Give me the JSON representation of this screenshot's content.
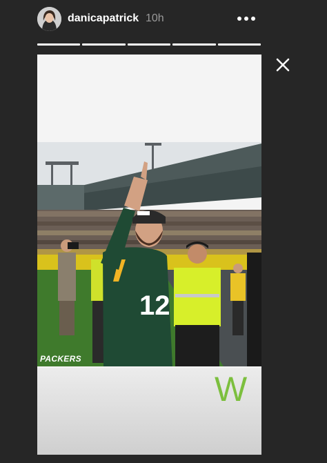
{
  "story": {
    "username": "danicapatrick",
    "timestamp": "10h",
    "segment_count": 5,
    "photo_watermark": "PACKERS",
    "caption_letter": "W"
  },
  "jersey_number": "12",
  "colors": {
    "background": "#262626",
    "accent_green": "#7cbf3e",
    "text_primary": "#ffffff",
    "text_secondary": "#9a9a9a"
  },
  "icons": {
    "more": "more-horizontal-icon",
    "close": "close-icon"
  }
}
